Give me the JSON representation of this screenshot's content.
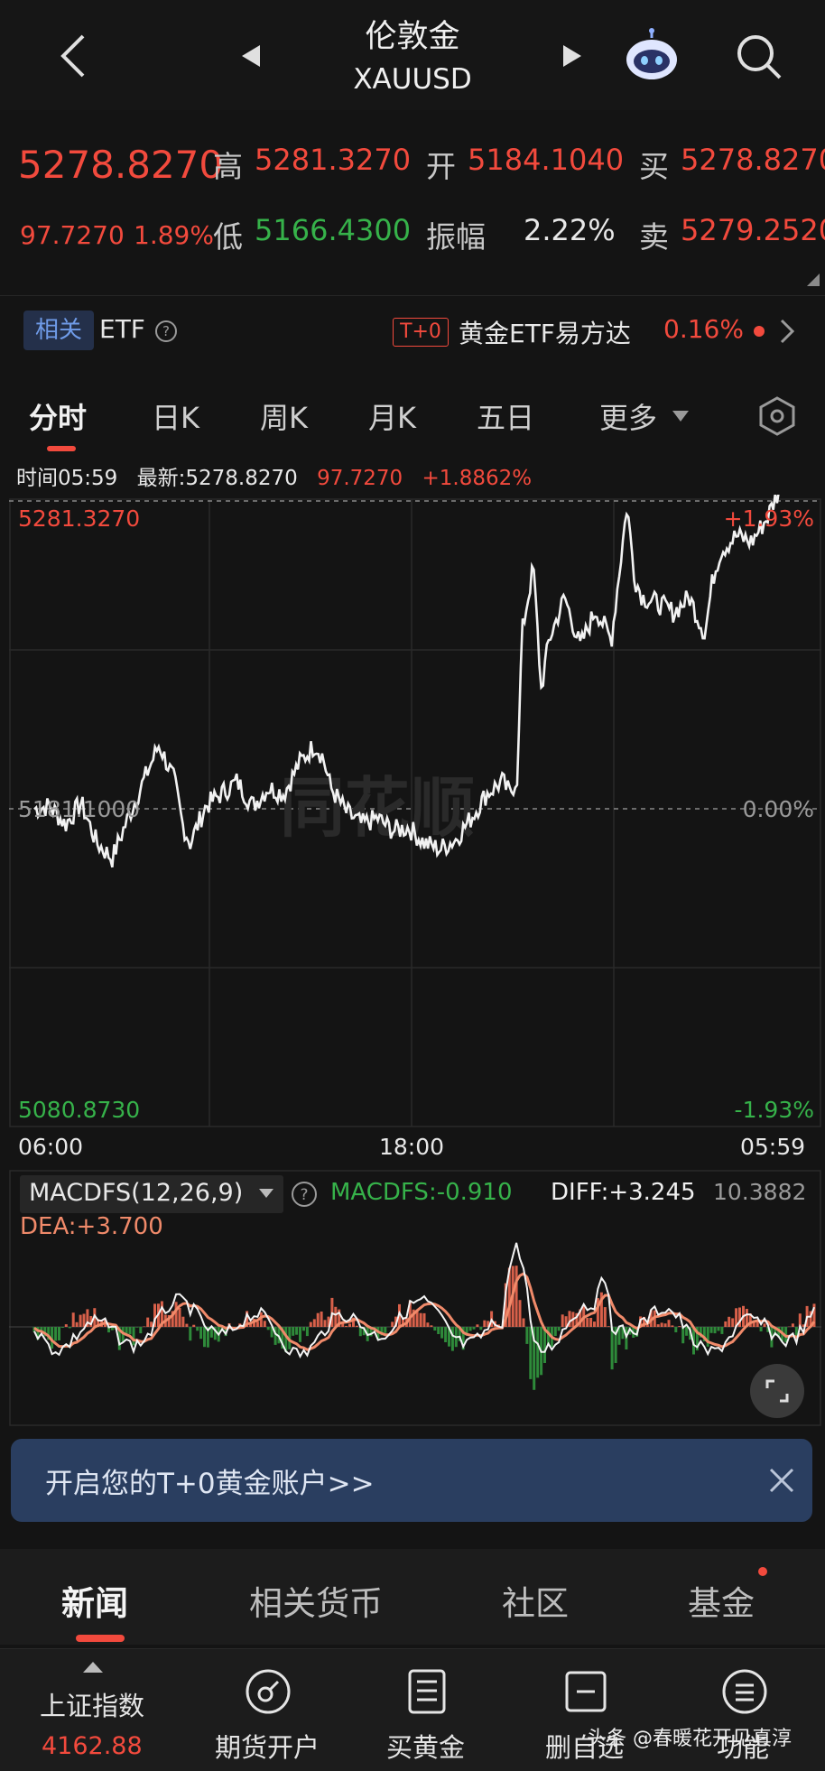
{
  "header": {
    "title": "伦敦金",
    "subtitle": "XAUUSD"
  },
  "quote": {
    "price": "5278.8270",
    "change_abs": "97.7270",
    "change_pct": "1.89%",
    "high_label": "高",
    "high": "5281.3270",
    "low_label": "低",
    "low": "5166.4300",
    "open_label": "开",
    "open": "5184.1040",
    "amp_label": "振幅",
    "amplitude": "2.22%",
    "buy_label": "买",
    "buy": "5278.8270",
    "sell_label": "卖",
    "sell": "5279.2520"
  },
  "related": {
    "tag": "相关",
    "etf_label": "ETF",
    "t0_tag": "T+0",
    "etf_name": "黄金ETF易方达",
    "etf_pct": "0.16%"
  },
  "tabs": [
    "分时",
    "日K",
    "周K",
    "月K",
    "五日",
    "更多"
  ],
  "info": {
    "time": "时间05:59",
    "latest": "最新:5278.8270",
    "change": "97.7270",
    "pct": "+1.8862%"
  },
  "chart_data": {
    "type": "line",
    "title": "",
    "y_top": "5281.3270",
    "y_mid": "5181.1000",
    "y_bottom": "5080.8730",
    "pct_top": "+1.93%",
    "pct_mid": "0.00%",
    "pct_bottom": "-1.93%",
    "x_ticks": [
      "06:00",
      "18:00",
      "05:59"
    ],
    "ylim": [
      5080.873,
      5281.327
    ],
    "keyframes": [
      [
        0,
        5181
      ],
      [
        0.02,
        5182
      ],
      [
        0.04,
        5176
      ],
      [
        0.06,
        5183
      ],
      [
        0.08,
        5170
      ],
      [
        0.1,
        5165
      ],
      [
        0.12,
        5178
      ],
      [
        0.14,
        5190
      ],
      [
        0.16,
        5202
      ],
      [
        0.18,
        5190
      ],
      [
        0.19,
        5176
      ],
      [
        0.2,
        5170
      ],
      [
        0.22,
        5182
      ],
      [
        0.24,
        5186
      ],
      [
        0.26,
        5190
      ],
      [
        0.28,
        5182
      ],
      [
        0.3,
        5188
      ],
      [
        0.32,
        5186
      ],
      [
        0.34,
        5196
      ],
      [
        0.36,
        5202
      ],
      [
        0.37,
        5198
      ],
      [
        0.38,
        5188
      ],
      [
        0.4,
        5180
      ],
      [
        0.42,
        5176
      ],
      [
        0.44,
        5178
      ],
      [
        0.46,
        5174
      ],
      [
        0.48,
        5175
      ],
      [
        0.5,
        5170
      ],
      [
        0.52,
        5168
      ],
      [
        0.54,
        5171
      ],
      [
        0.56,
        5178
      ],
      [
        0.58,
        5186
      ],
      [
        0.6,
        5190
      ],
      [
        0.61,
        5186
      ],
      [
        0.62,
        5192
      ],
      [
        0.625,
        5238
      ],
      [
        0.64,
        5260
      ],
      [
        0.65,
        5220
      ],
      [
        0.66,
        5236
      ],
      [
        0.68,
        5250
      ],
      [
        0.7,
        5234
      ],
      [
        0.72,
        5246
      ],
      [
        0.74,
        5236
      ],
      [
        0.75,
        5258
      ],
      [
        0.76,
        5280
      ],
      [
        0.77,
        5256
      ],
      [
        0.78,
        5250
      ],
      [
        0.8,
        5248
      ],
      [
        0.82,
        5245
      ],
      [
        0.84,
        5250
      ],
      [
        0.86,
        5238
      ],
      [
        0.87,
        5256
      ],
      [
        0.88,
        5265
      ],
      [
        0.9,
        5270
      ],
      [
        0.92,
        5268
      ],
      [
        0.94,
        5276
      ],
      [
        0.96,
        5288
      ],
      [
        0.98,
        5295
      ],
      [
        1.0,
        5303
      ]
    ]
  },
  "macd": {
    "selector": "MACDFS(12,26,9)",
    "macdfs": "MACDFS:-0.910",
    "diff": "DIFF:+3.245",
    "top_value": "10.3882",
    "dea": "DEA:+3.700"
  },
  "banner": {
    "text": "开启您的T+0黄金账户>>"
  },
  "news_tabs": [
    "新闻",
    "相关货币",
    "社区",
    "基金"
  ],
  "bottom_nav": {
    "index_name": "上证指数",
    "index_value": "4162.88",
    "items": [
      "期货开户",
      "买黄金",
      "删自选",
      "功能"
    ]
  },
  "watermark": "头条 @春暖花开见真淳",
  "colors": {
    "up": "#f24a3d",
    "down": "#36b24a",
    "background": "#141414",
    "banner": "#2a3e60"
  }
}
